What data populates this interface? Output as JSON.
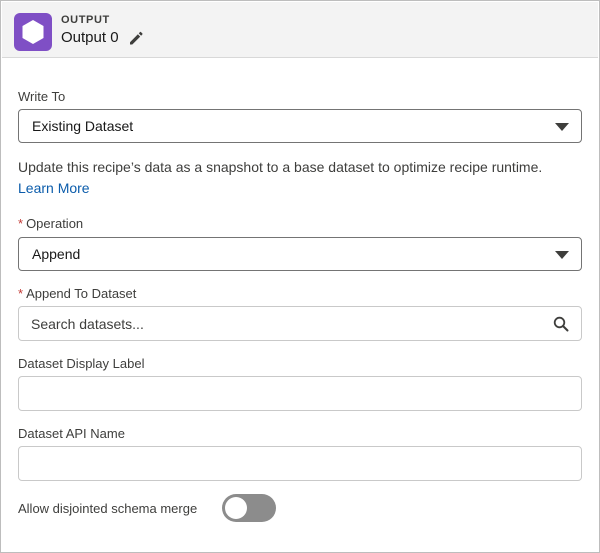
{
  "header": {
    "eyebrow": "OUTPUT",
    "title": "Output 0",
    "node_icon": "hexagon-icon",
    "edit_icon": "pencil-icon",
    "icon_color": "#7f4fc5"
  },
  "write_to": {
    "label": "Write To",
    "value": "Existing Dataset"
  },
  "help": {
    "text": "Update this recipe’s data as a snapshot to a base dataset to optimize recipe runtime.",
    "link": "Learn More"
  },
  "operation": {
    "required_marker": "*",
    "label": "Operation",
    "value": "Append"
  },
  "append_to_dataset": {
    "required_marker": "*",
    "label": "Append To Dataset",
    "placeholder": "Search datasets...",
    "value": ""
  },
  "display_label": {
    "label": "Dataset Display Label",
    "value": ""
  },
  "api_name": {
    "label": "Dataset API Name",
    "value": ""
  },
  "schema_merge": {
    "label": "Allow disjointed schema merge",
    "enabled": false
  },
  "colors": {
    "link": "#0b5cab",
    "required": "#c23934",
    "toggle_off": "#8c8c8c"
  }
}
